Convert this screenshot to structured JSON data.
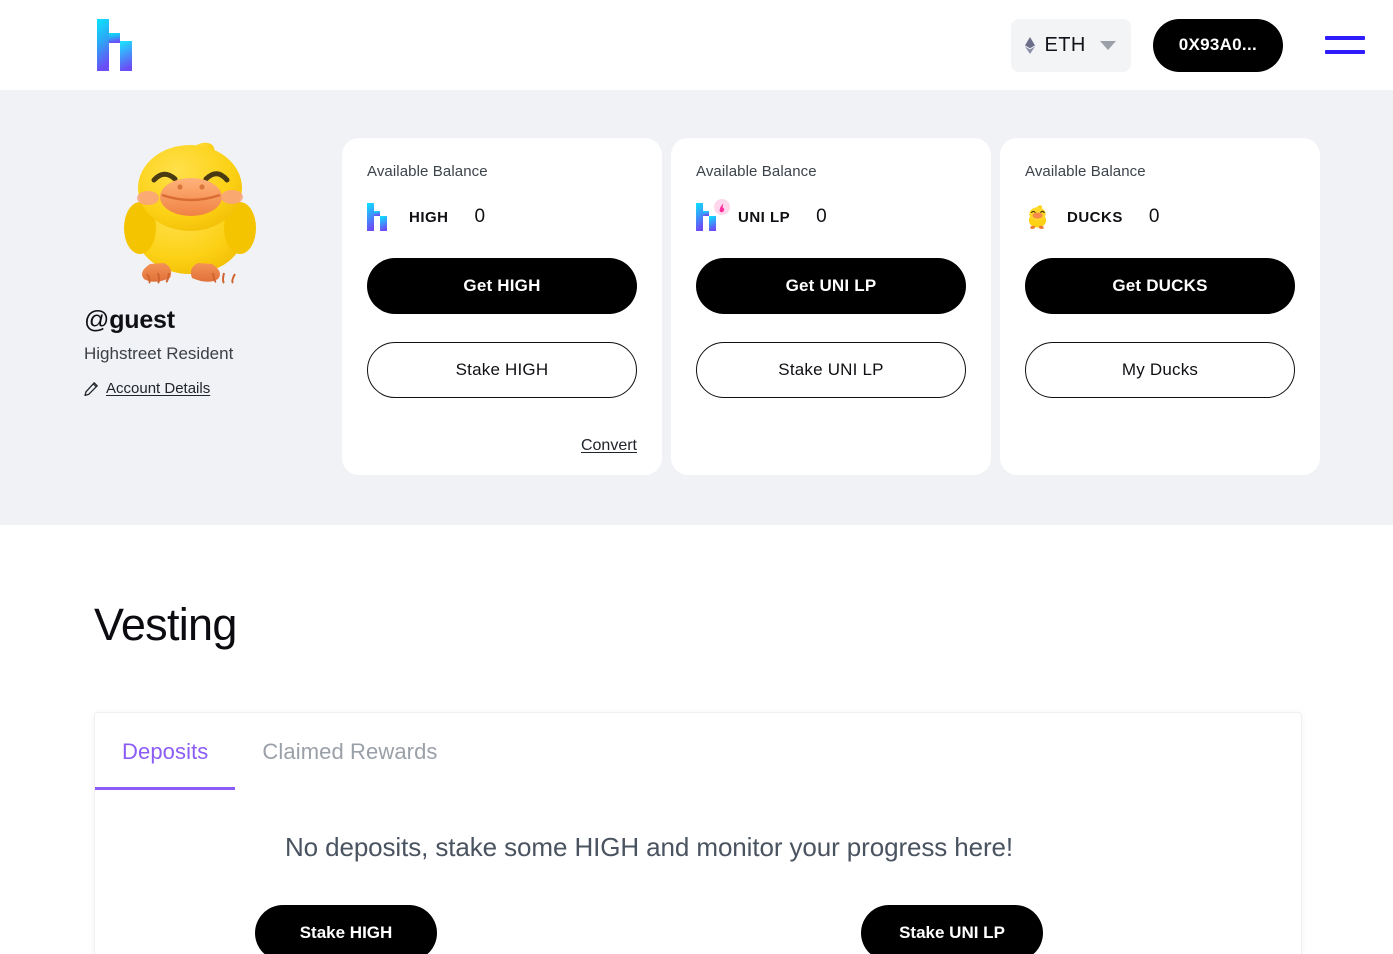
{
  "header": {
    "logo_icon": "highstreet-h-logo",
    "chain": {
      "icon": "ethereum-icon",
      "label": "ETH",
      "caret_icon": "chevron-down-icon"
    },
    "wallet_label": "0X93A0...",
    "menu_icon": "hamburger-menu-icon"
  },
  "profile": {
    "avatar_icon": "duck-avatar",
    "handle_prefix": "@",
    "handle": "guest",
    "subtitle": "Highstreet Resident",
    "edit_icon": "pencil-icon",
    "account_details_label": "Account Details"
  },
  "balance_cards": [
    {
      "label": "Available Balance",
      "token_icon": "high-token-icon",
      "token": "HIGH",
      "amount": "0",
      "primary_label": "Get HIGH",
      "secondary_label": "Stake HIGH",
      "convert_label": "Convert"
    },
    {
      "label": "Available Balance",
      "token_icon": "uni-lp-token-icon",
      "token": "UNI LP",
      "amount": "0",
      "primary_label": "Get UNI LP",
      "secondary_label": "Stake UNI LP",
      "convert_label": ""
    },
    {
      "label": "Available Balance",
      "token_icon": "ducks-token-icon",
      "token": "DUCKS",
      "amount": "0",
      "primary_label": "Get DUCKS",
      "secondary_label": "My Ducks",
      "convert_label": ""
    }
  ],
  "vesting": {
    "title": "Vesting",
    "tabs": [
      {
        "label": "Deposits",
        "active": true
      },
      {
        "label": "Claimed Rewards",
        "active": false
      }
    ],
    "empty_message": "No deposits, stake some HIGH and monitor your progress here!",
    "actions": [
      {
        "label": "Stake HIGH"
      },
      {
        "label": "Stake UNI LP"
      }
    ]
  },
  "colors": {
    "accent_purple": "#8b5cf6",
    "menu_blue": "#2e1dfa",
    "hero_bg": "#f1f2f5",
    "button_black": "#000000"
  }
}
